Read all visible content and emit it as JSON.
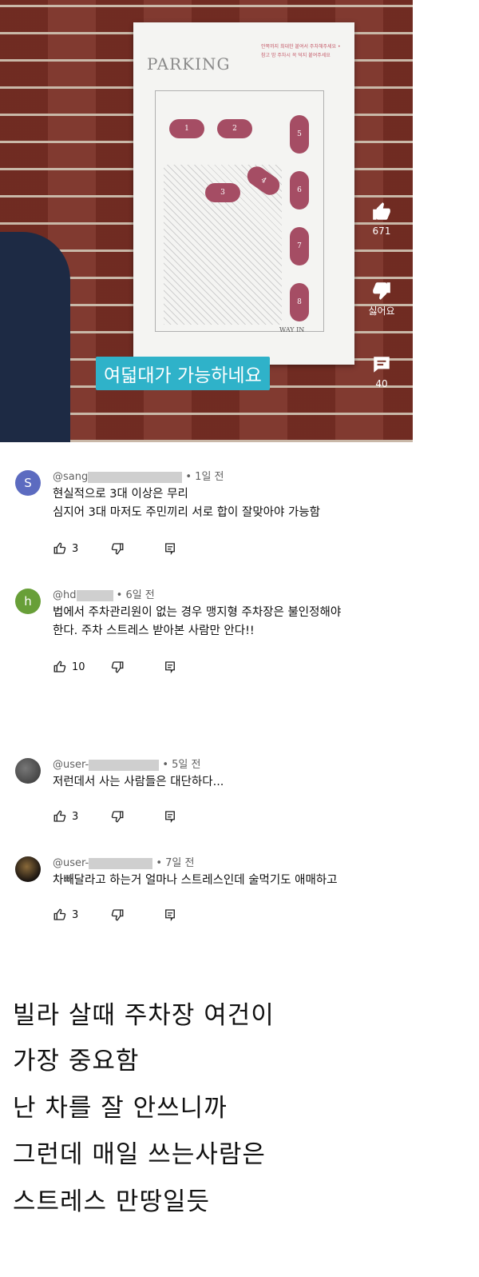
{
  "video": {
    "poster_title": "PARKING",
    "poster_note": "안쪽까지 최대한 붙여서 주차해주세요 •참고 밤 주차시 꼭 덕지 붙여주세요",
    "car_numbers": [
      "1",
      "2",
      "3",
      "4",
      "5",
      "6",
      "7",
      "8"
    ],
    "way_in": "WAY IN",
    "caption": "여덟대가 가능하네요",
    "like_count": "671",
    "dislike_label": "싫어요",
    "comment_count": "40"
  },
  "comments": [
    {
      "avatar_letter": "S",
      "avatar_color": "#5c6bc0",
      "handle": "@sang",
      "time": "• 1일 전",
      "lines": [
        "현실적으로 3대 이상은 무리",
        "심지어 3대 마저도 주민끼리 서로 합이 잘맞아야 가능함"
      ],
      "likes": "3"
    },
    {
      "avatar_letter": "h",
      "avatar_color": "#689f38",
      "handle": "@hd",
      "time": "• 6일 전",
      "lines": [
        "법에서 주차관리원이 없는 경우 맹지형 주차장은 불인정해야",
        "한다. 주차 스트레스 받아본 사람만 안다!!"
      ],
      "likes": "10"
    },
    {
      "avatar_letter": "",
      "avatar_color": "#4a4a4a",
      "handle": "@user-",
      "time": "• 5일 전",
      "lines": [
        "저런데서 사는 사람들은 대단하다..."
      ],
      "likes": "3"
    },
    {
      "avatar_letter": "",
      "avatar_color": "#2b2420",
      "handle": "@user-",
      "time": "• 7일 전",
      "lines": [
        "차빼달라고 하는거 얼마나 스트레스인데 술먹기도 애매하고"
      ],
      "likes": "3"
    }
  ],
  "post_lines": [
    "빌라 살때 주차장 여건이",
    "가장 중요함",
    "난 차를 잘 안쓰니까",
    "그런데 매일 쓰는사람은",
    "스트레스 만땅일듯"
  ]
}
